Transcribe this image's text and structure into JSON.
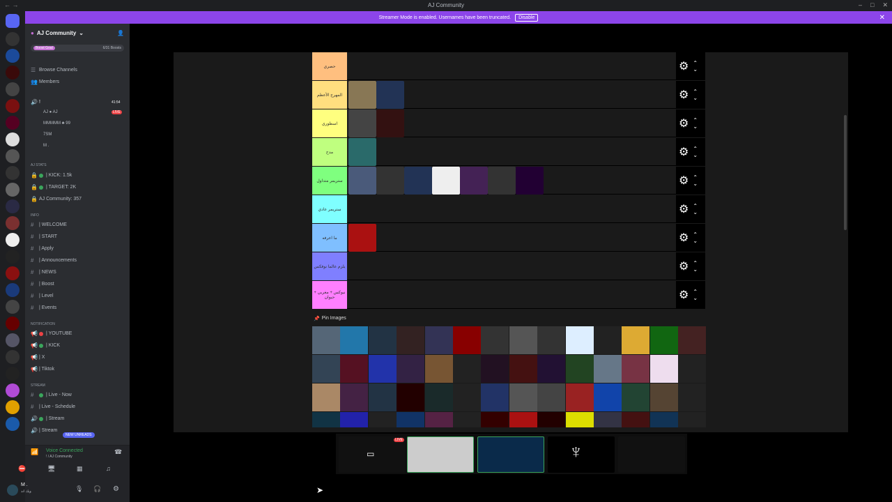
{
  "window": {
    "title": "AJ Community",
    "nav": "← →"
  },
  "banner": {
    "text": "Streamer Mode is enabled. Usernames have been truncated.",
    "button": "Disable"
  },
  "guild": {
    "name": "AJ Community",
    "boost_tag": "Boost Goal",
    "boost_count": "6/31 Boosts"
  },
  "nav_items": [
    {
      "label": "Browse Channels"
    },
    {
      "label": "Members"
    }
  ],
  "voice_channel": {
    "name": "!",
    "time": "41:54",
    "users": [
      {
        "name": "AJ ● AJ",
        "live": "LIVE"
      },
      {
        "name": "MMMMM ♣ 99"
      },
      {
        "name": "7SM"
      },
      {
        "name": "M ."
      }
    ]
  },
  "stats_category": "AJ Stats",
  "stats": [
    "| KICK: 1.5k",
    "| TARGET: 2K",
    "AJ Community: 357"
  ],
  "info_category": "Info",
  "info_channels": [
    "| WELCOME",
    "| START",
    "| Apply",
    "| Announcements",
    "| NEWS",
    "| Boost",
    "| Level",
    "| Events"
  ],
  "notif_category": "NOTIFICATION",
  "notif_channels": [
    "| YOUTUBE",
    "| KICK",
    "| X",
    "| Tiktok"
  ],
  "stream_category": "STREAM",
  "stream_channels": [
    "| Live - Now",
    "| Live - Schedule",
    "| Stream",
    "| Stream"
  ],
  "new_unreads": "NEW UNREADS",
  "voicebar": {
    "status": "Voice Connected",
    "sub": "! / AJ Community"
  },
  "userbar": {
    "name": "M .",
    "sub": "ويك اند"
  },
  "tiers": [
    {
      "label": "حصري",
      "color": "#ffbf7f"
    },
    {
      "label": "المهرج الأعظم",
      "color": "#ffdf7f"
    },
    {
      "label": "اسطوري",
      "color": "#ffff7f"
    },
    {
      "label": "مدح",
      "color": "#bfff7f"
    },
    {
      "label": "ستريمر متداول",
      "color": "#7fff7f"
    },
    {
      "label": "ستريمر عادي",
      "color": "#7fffff"
    },
    {
      "label": "ما اعرفه",
      "color": "#7fbfff"
    },
    {
      "label": "يلزم عالما نوفكس",
      "color": "#7f7fff"
    },
    {
      "label": "نيوكس + مغربي + حيوان",
      "color": "#ff7fff"
    }
  ],
  "pin_header": "Pin Images",
  "stream_live": "LIVE"
}
